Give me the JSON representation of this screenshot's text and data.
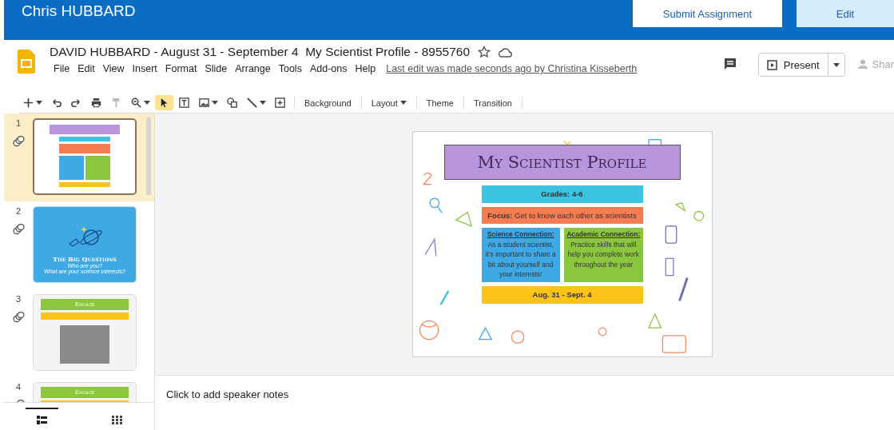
{
  "header": {
    "user": "Chris HUBBARD",
    "buttons": [
      {
        "label": "Submit Assignment",
        "kind": "secondary"
      },
      {
        "label": "Edit",
        "kind": "primary"
      }
    ]
  },
  "doc": {
    "title": "DAVID HUBBARD - August 31 - September 4  My Scientist Profile - 8955760",
    "starred": false,
    "menu": [
      "File",
      "Edit",
      "View",
      "Insert",
      "Format",
      "Slide",
      "Arrange",
      "Tools",
      "Add-ons",
      "Help"
    ],
    "last_edit": "Last edit was made seconds ago by Christina Kisseberth",
    "present": "Present",
    "share": "Shar"
  },
  "toolbar": {
    "tools": [
      {
        "kind": "plus",
        "dropdown": true,
        "selected": false
      },
      {
        "kind": "undo",
        "dropdown": false,
        "selected": false
      },
      {
        "kind": "redo",
        "dropdown": false,
        "selected": false
      },
      {
        "kind": "print",
        "dropdown": false,
        "selected": false
      },
      {
        "kind": "paint",
        "dropdown": false,
        "selected": false
      },
      {
        "kind": "zoom",
        "dropdown": true,
        "selected": false
      },
      {
        "kind": "cursor",
        "dropdown": false,
        "selected": true
      },
      {
        "kind": "textbox",
        "dropdown": false,
        "selected": false
      },
      {
        "kind": "image",
        "dropdown": true,
        "selected": false
      },
      {
        "kind": "shape",
        "dropdown": false,
        "selected": false
      },
      {
        "kind": "line",
        "dropdown": true,
        "selected": false
      },
      {
        "kind": "comment",
        "dropdown": false,
        "selected": false
      }
    ],
    "text_buttons": [
      {
        "label": "Background",
        "dropdown": false
      },
      {
        "label": "Layout",
        "dropdown": true
      },
      {
        "label": "Theme",
        "dropdown": false
      },
      {
        "label": "Transition",
        "dropdown": false
      }
    ]
  },
  "slides": [
    {
      "number": "1",
      "selected": true,
      "kind": "profile"
    },
    {
      "number": "2",
      "selected": false,
      "kind": "questions",
      "title": "The Big Questions",
      "lines": [
        "Who are you?",
        "What are your science interests?"
      ]
    },
    {
      "number": "3",
      "selected": false,
      "kind": "engage",
      "title": "Engage",
      "photo": true
    },
    {
      "number": "4",
      "selected": false,
      "kind": "engage",
      "title": "Engage"
    }
  ],
  "view_toggle": [
    {
      "kind": "filmstrip",
      "selected": true
    },
    {
      "kind": "grid",
      "selected": false
    }
  ],
  "slide": {
    "title": "My Scientist Profile",
    "grades": "Grades: 4-6",
    "focus": "**Focus:** Get to know each other as scientists",
    "columns": [
      {
        "heading": "Science Connection:",
        "text": "As a student scientist, it's important to share a bit about yourself and your interests!",
        "color": "#3fa9e6"
      },
      {
        "heading": "Academic Connection:",
        "text": "Practice skills that will help you complete work throughout the year",
        "color": "#8cc63f"
      }
    ],
    "dates": "Aug. 31 - Sept. 4"
  },
  "notes": {
    "placeholder": "Click to add speaker notes"
  }
}
